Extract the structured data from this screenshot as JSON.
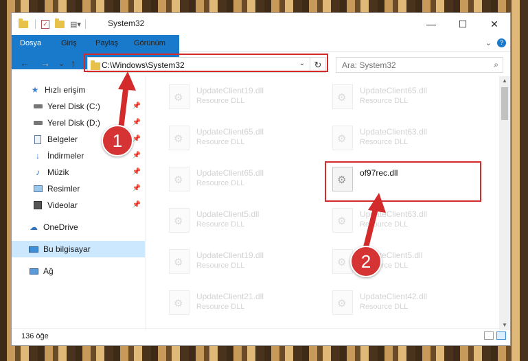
{
  "window": {
    "title": "System32",
    "controls": {
      "minimize": "—",
      "maximize": "☐",
      "close": "✕"
    }
  },
  "ribbon": {
    "tabs": [
      "Dosya",
      "Giriş",
      "Paylaş",
      "Görünüm"
    ]
  },
  "nav": {
    "back": "←",
    "forward": "→",
    "recent": "⌄",
    "up": "↑",
    "address_path": "C:\\Windows\\System32",
    "search_placeholder": "Ara: System32"
  },
  "sidebar": {
    "items": [
      {
        "label": "Hızlı erişim",
        "icon": "star-icon",
        "pinned": false
      },
      {
        "label": "Yerel Disk (C:)",
        "icon": "drive-icon",
        "pinned": true
      },
      {
        "label": "Yerel Disk (D:)",
        "icon": "drive-icon",
        "pinned": true
      },
      {
        "label": "Belgeler",
        "icon": "documents-icon",
        "pinned": true
      },
      {
        "label": "İndirmeler",
        "icon": "download-icon",
        "pinned": true
      },
      {
        "label": "Müzik",
        "icon": "music-icon",
        "pinned": true
      },
      {
        "label": "Resimler",
        "icon": "pictures-icon",
        "pinned": true
      },
      {
        "label": "Videolar",
        "icon": "video-icon",
        "pinned": true
      },
      {
        "label": "OneDrive",
        "icon": "cloud-icon",
        "pinned": false
      },
      {
        "label": "Bu bilgisayar",
        "icon": "computer-icon",
        "pinned": false,
        "selected": true
      },
      {
        "label": "Ağ",
        "icon": "network-icon",
        "pinned": false
      }
    ]
  },
  "files": [
    {
      "name": "UpdateClient19.dll",
      "type": "Resource DLL",
      "faded": true
    },
    {
      "name": "UpdateClient65.dll",
      "type": "Resource DLL",
      "faded": true
    },
    {
      "name": "UpdateClient65.dll",
      "type": "Resource DLL",
      "faded": true
    },
    {
      "name": "UpdateClient63.dll",
      "type": "Resource DLL",
      "faded": true
    },
    {
      "name": "UpdateClient65.dll",
      "type": "Resource DLL",
      "faded": true
    },
    {
      "name": "of97rec.dll",
      "type": "",
      "faded": false
    },
    {
      "name": "UpdateClient5.dll",
      "type": "Resource DLL",
      "faded": true
    },
    {
      "name": "UpdateClient63.dll",
      "type": "Resource DLL",
      "faded": true
    },
    {
      "name": "UpdateClient19.dll",
      "type": "Resource DLL",
      "faded": true
    },
    {
      "name": "UpdateClient5.dll",
      "type": "Resource DLL",
      "faded": true
    },
    {
      "name": "UpdateClient21.dll",
      "type": "Resource DLL",
      "faded": true
    },
    {
      "name": "UpdateClient42.dll",
      "type": "Resource DLL",
      "faded": true
    }
  ],
  "status": {
    "count": "136 öğe"
  },
  "annotations": {
    "step1": "1",
    "step2": "2"
  },
  "colors": {
    "accent": "#1979ca",
    "highlight_red": "#d32b2b",
    "selected_bg": "#cce8ff"
  }
}
